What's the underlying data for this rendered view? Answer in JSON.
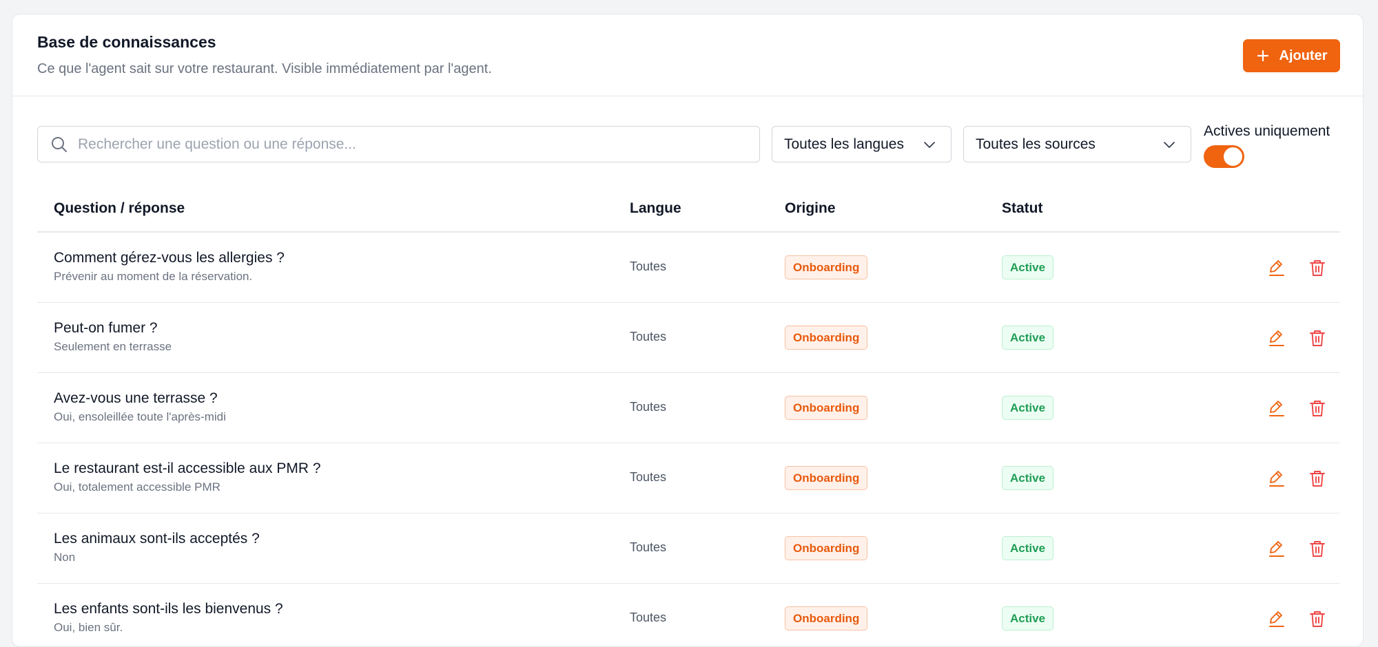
{
  "header": {
    "title": "Base de connaissances",
    "subtitle": "Ce que l'agent sait sur votre restaurant. Visible immédiatement par l'agent.",
    "add_label": "Ajouter"
  },
  "filters": {
    "search_placeholder": "Rechercher une question ou une réponse...",
    "language_selected": "Toutes les langues",
    "source_selected": "Toutes les sources",
    "active_only_label": "Actives uniquement",
    "active_only_on": true
  },
  "table": {
    "columns": {
      "question": "Question / réponse",
      "language": "Langue",
      "origin": "Origine",
      "status": "Statut"
    },
    "rows": [
      {
        "question": "Comment gérez-vous les allergies ?",
        "answer": "Prévenir au moment de la réservation.",
        "language": "Toutes",
        "origin": "Onboarding",
        "status": "Active"
      },
      {
        "question": "Peut-on fumer ?",
        "answer": "Seulement en terrasse",
        "language": "Toutes",
        "origin": "Onboarding",
        "status": "Active"
      },
      {
        "question": "Avez-vous une terrasse ?",
        "answer": "Oui, ensoleillée toute l'après-midi",
        "language": "Toutes",
        "origin": "Onboarding",
        "status": "Active"
      },
      {
        "question": "Le restaurant est-il accessible aux PMR ?",
        "answer": "Oui, totalement accessible PMR",
        "language": "Toutes",
        "origin": "Onboarding",
        "status": "Active"
      },
      {
        "question": "Les animaux sont-ils acceptés ?",
        "answer": "Non",
        "language": "Toutes",
        "origin": "Onboarding",
        "status": "Active"
      },
      {
        "question": "Les enfants sont-ils les bienvenus ?",
        "answer": "Oui, bien sûr.",
        "language": "Toutes",
        "origin": "Onboarding",
        "status": "Active"
      }
    ]
  },
  "icons": {
    "search": "search-icon",
    "chevron": "chevron-down-icon",
    "plus": "plus-icon",
    "edit": "pencil-icon",
    "delete": "trash-icon"
  },
  "colors": {
    "accent": "#f0630f",
    "origin_badge_text": "#e8590c",
    "status_badge_text": "#1f9d55",
    "delete_icon": "#ef4444"
  }
}
